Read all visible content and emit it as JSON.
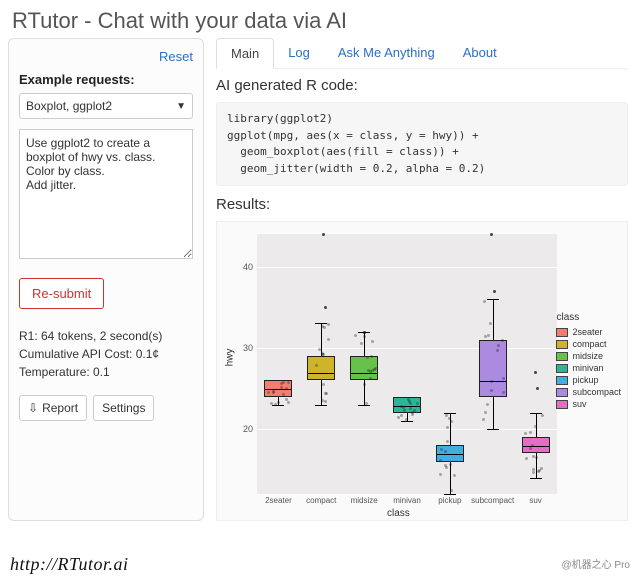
{
  "header": {
    "title": "RTutor - Chat with your data via AI"
  },
  "sidebar": {
    "reset_label": "Reset",
    "example_label": "Example requests:",
    "select_value": "Boxplot, ggplot2",
    "request_text": "Use ggplot2 to create a boxplot of hwy vs. class.\nColor by class.\nAdd jitter.",
    "resubmit_label": "Re-submit",
    "stats_line1": "R1: 64 tokens, 2 second(s)",
    "stats_line2": "Cumulative API Cost: 0.1¢",
    "stats_line3": "Temperature: 0.1",
    "report_label": "Report",
    "settings_label": "Settings"
  },
  "tabs": {
    "main": "Main",
    "log": "Log",
    "ama": "Ask Me Anything",
    "about": "About"
  },
  "main": {
    "code_heading": "AI generated R code:",
    "code_text": "library(ggplot2)\nggplot(mpg, aes(x = class, y = hwy)) +\n  geom_boxplot(aes(fill = class)) +\n  geom_jitter(width = 0.2, alpha = 0.2)",
    "results_heading": "Results:"
  },
  "chart_data": {
    "type": "boxplot",
    "xlabel": "class",
    "ylabel": "hwy",
    "ylim": [
      12,
      44
    ],
    "yticks": [
      20,
      30,
      40
    ],
    "legend_title": "class",
    "legend_position": "right",
    "categories": [
      "2seater",
      "compact",
      "midsize",
      "minivan",
      "pickup",
      "subcompact",
      "suv"
    ],
    "colors": [
      "#f57d6f",
      "#cdb42a",
      "#66c24b",
      "#2bb797",
      "#42aee0",
      "#ac8ae0",
      "#e66ec0"
    ],
    "series": [
      {
        "name": "2seater",
        "q1": 24,
        "median": 25,
        "q3": 26,
        "lower": 23,
        "upper": 26
      },
      {
        "name": "compact",
        "q1": 26,
        "median": 27,
        "q3": 29,
        "lower": 23,
        "upper": 33
      },
      {
        "name": "midsize",
        "q1": 26,
        "median": 27,
        "q3": 29,
        "lower": 23,
        "upper": 32
      },
      {
        "name": "minivan",
        "q1": 22,
        "median": 23,
        "q3": 24,
        "lower": 21,
        "upper": 24
      },
      {
        "name": "pickup",
        "q1": 16,
        "median": 17,
        "q3": 18,
        "lower": 12,
        "upper": 22
      },
      {
        "name": "subcompact",
        "q1": 24,
        "median": 26,
        "q3": 31,
        "lower": 20,
        "upper": 36
      },
      {
        "name": "suv",
        "q1": 17,
        "median": 18,
        "q3": 19,
        "lower": 14,
        "upper": 22
      }
    ],
    "outliers": [
      {
        "category": "compact",
        "value": 35
      },
      {
        "category": "compact",
        "value": 44
      },
      {
        "category": "midsize",
        "value": 32
      },
      {
        "category": "subcompact",
        "value": 37
      },
      {
        "category": "subcompact",
        "value": 44
      },
      {
        "category": "suv",
        "value": 25
      },
      {
        "category": "suv",
        "value": 27
      }
    ]
  },
  "footer": {
    "url": "http://RTutor.ai",
    "watermark": "@机器之心 Pro"
  }
}
